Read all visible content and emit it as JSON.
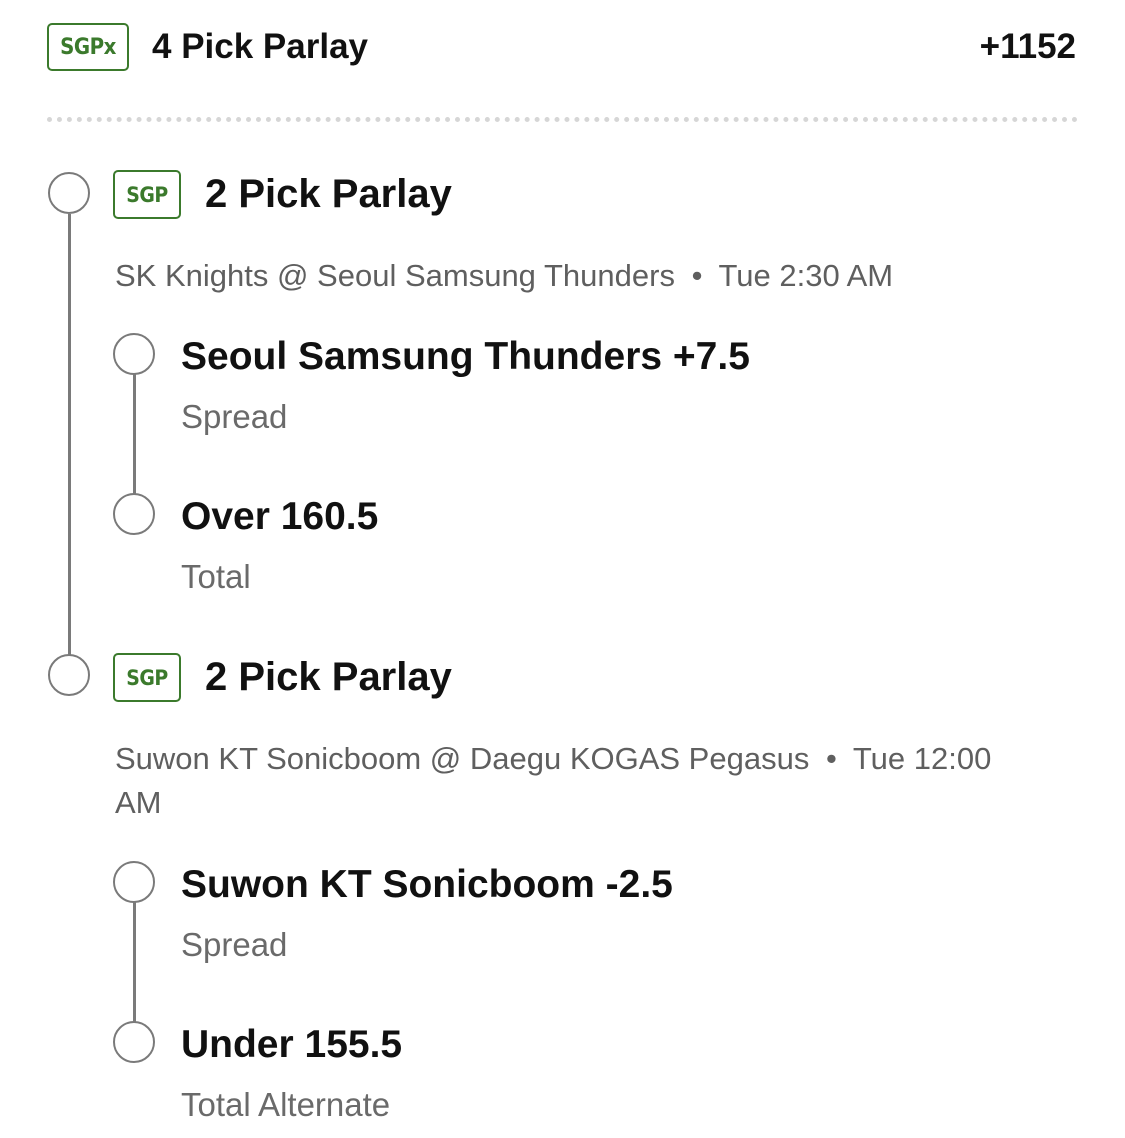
{
  "parlay": {
    "badge": "SGPx",
    "title": "4 Pick Parlay",
    "odds": "+1152"
  },
  "groups": [
    {
      "badge": "SGP",
      "title": "2 Pick Parlay",
      "matchup": "SK Knights @ Seoul Samsung Thunders",
      "separator": "•",
      "time": "Tue 2:30 AM",
      "legs": [
        {
          "selection": "Seoul Samsung Thunders +7.5",
          "market": "Spread"
        },
        {
          "selection": "Over 160.5",
          "market": "Total"
        }
      ]
    },
    {
      "badge": "SGP",
      "title": "2 Pick Parlay",
      "matchup": "Suwon KT Sonicboom @ Daegu KOGAS Pegasus",
      "separator": "•",
      "time": "Tue 12:00 AM",
      "legs": [
        {
          "selection": "Suwon KT Sonicboom -2.5",
          "market": "Spread"
        },
        {
          "selection": "Under 155.5",
          "market": "Total Alternate"
        }
      ]
    }
  ],
  "colors": {
    "badge_green": "#3b7a2c",
    "timeline_gray": "#7a7a7a",
    "secondary_text": "#5f5f5f"
  }
}
